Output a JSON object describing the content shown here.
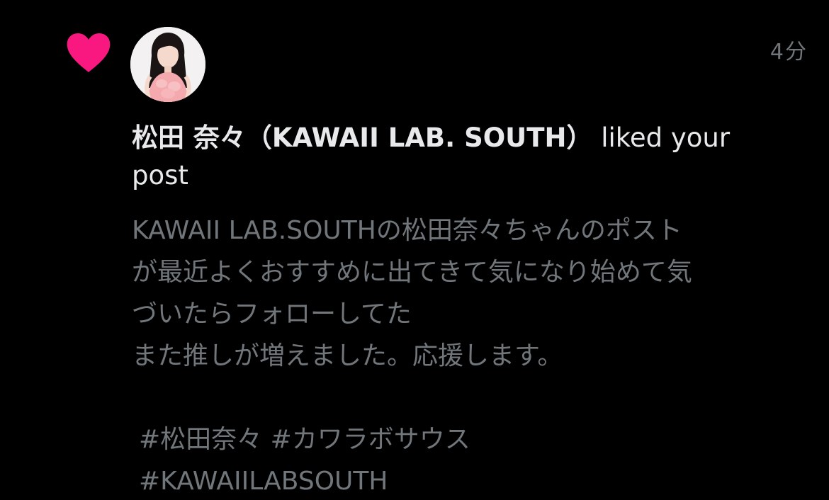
{
  "notification": {
    "type_icon": "heart-icon",
    "type_icon_color": "#f91880",
    "timestamp": "4分",
    "user_name": "松田 奈々（KAWAII LAB. SOUTH）",
    "action_text": " liked your post",
    "post": {
      "lines": [
        "KAWAII LAB.SOUTHの松田奈々ちゃんのポスト",
        "が最近よくおすすめに出てきて気になり始めて気",
        "づいたらフォローしてた",
        "また推しが増えました。応援します。"
      ],
      "hashtags_line1": [
        "#松田奈々",
        "#カワラボサウス"
      ],
      "hashtags_line2": [
        "#KAWAIILABSOUTH"
      ]
    }
  },
  "colors": {
    "background": "#000000",
    "primary_text": "#e7e9ea",
    "secondary_text": "#71767b",
    "like_pink": "#f91880"
  }
}
